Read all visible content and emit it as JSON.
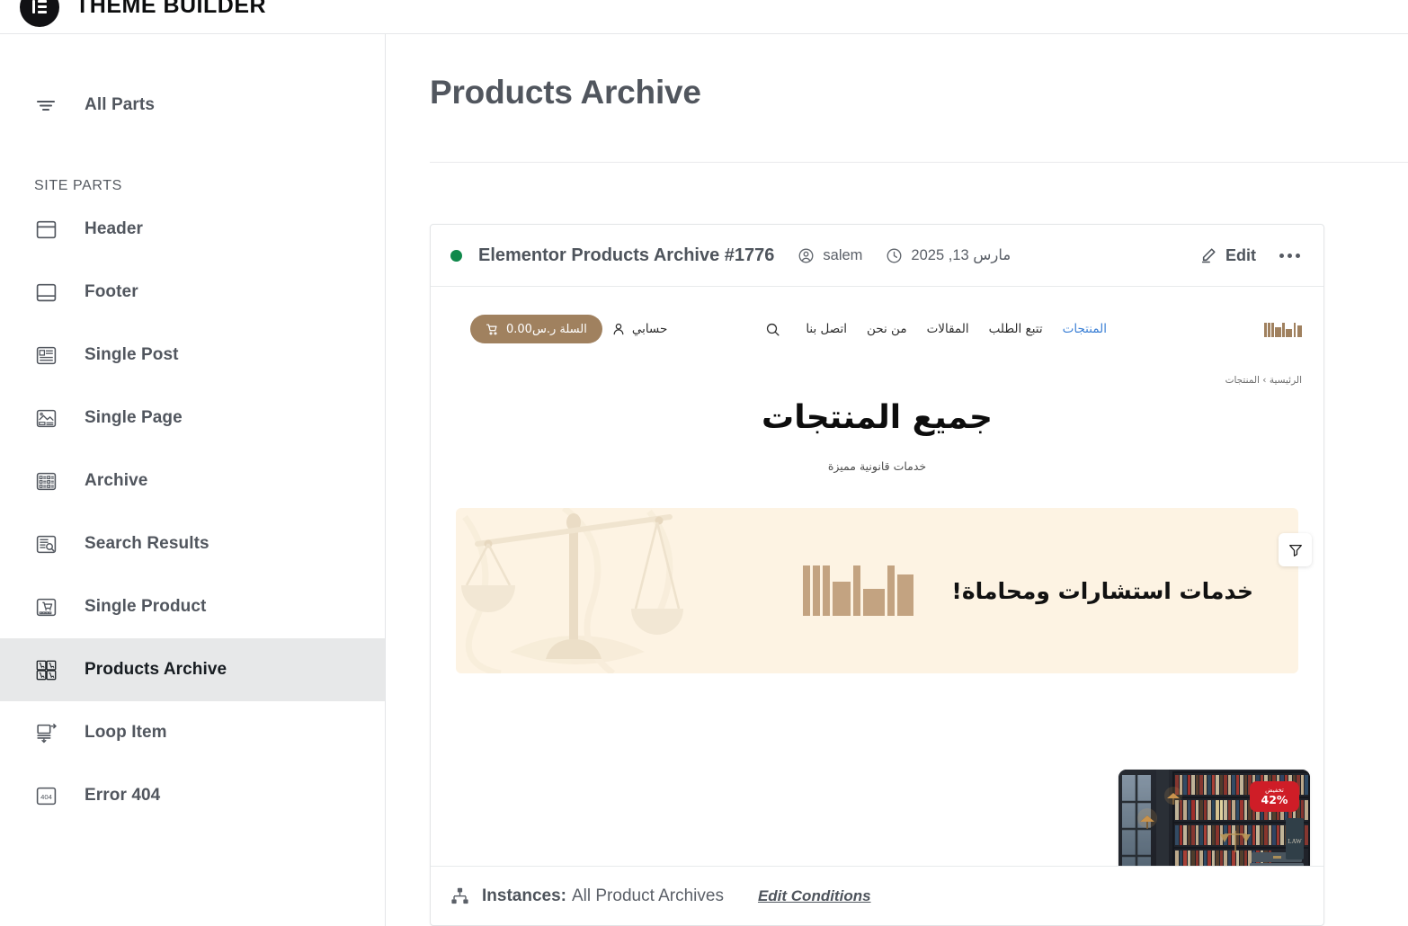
{
  "topbar": {
    "title": "THEME BUILDER",
    "logo_icon": "elementor-logo-icon"
  },
  "sidebar": {
    "all_parts": {
      "label": "All Parts",
      "icon": "filter-lines-icon"
    },
    "section_label": "SITE PARTS",
    "items": [
      {
        "label": "Header",
        "icon": "header-layout-icon",
        "active": false
      },
      {
        "label": "Footer",
        "icon": "footer-layout-icon",
        "active": false
      },
      {
        "label": "Single Post",
        "icon": "single-post-icon",
        "active": false
      },
      {
        "label": "Single Page",
        "icon": "single-page-icon",
        "active": false
      },
      {
        "label": "Archive",
        "icon": "archive-grid-icon",
        "active": false
      },
      {
        "label": "Search Results",
        "icon": "search-results-icon",
        "active": false
      },
      {
        "label": "Single Product",
        "icon": "single-product-icon",
        "active": false
      },
      {
        "label": "Products Archive",
        "icon": "products-archive-icon",
        "active": true
      },
      {
        "label": "Loop Item",
        "icon": "loop-item-icon",
        "active": false
      },
      {
        "label": "Error 404",
        "icon": "error-404-icon",
        "active": false
      }
    ]
  },
  "main": {
    "page_title": "Products Archive",
    "card": {
      "status": "published",
      "status_color": "#10884b",
      "title": "Elementor Products Archive #1776",
      "author": "salem",
      "author_icon": "user-circle-icon",
      "date": "مارس 13, 2025",
      "date_icon": "clock-icon",
      "edit_label": "Edit",
      "edit_icon": "pencil-icon",
      "more_icon": "more-horizontal-icon"
    },
    "preview": {
      "site_logo_icon": "alamal-brand-logo",
      "nav_links": [
        {
          "label": "المنتجات",
          "current": true
        },
        {
          "label": "تتبع الطلب",
          "current": false
        },
        {
          "label": "المقالات",
          "current": false
        },
        {
          "label": "من نحن",
          "current": false
        },
        {
          "label": "اتصل بنا",
          "current": false
        }
      ],
      "search_icon": "search-icon",
      "account": {
        "label": "حسابي",
        "icon": "user-icon"
      },
      "cart": {
        "label": "السلة ر.س0.00",
        "icon": "cart-icon",
        "color": "#a0815f"
      },
      "breadcrumb": "الرئيسية › المنتجات",
      "hero_title": "جميع المنتجات",
      "hero_subtitle": "خدمات قانونية مميزة",
      "filter_icon": "funnel-filter-icon",
      "banner": {
        "text": "خدمات استشارات ومحاماة!",
        "bg_color": "#fdf3e3",
        "logo_icon": "alamal-brand-logo",
        "decor_icon": "scales-of-justice-icon"
      },
      "product": {
        "image_alt": "law-library-gavel-photo",
        "sale_badge_top": "تخفيض",
        "sale_badge_value": "42%",
        "badge_color": "#cf1d27"
      }
    },
    "footer": {
      "icon": "sitemap-icon",
      "label": "Instances:",
      "value": "All Product Archives",
      "edit_conditions": "Edit Conditions"
    }
  }
}
